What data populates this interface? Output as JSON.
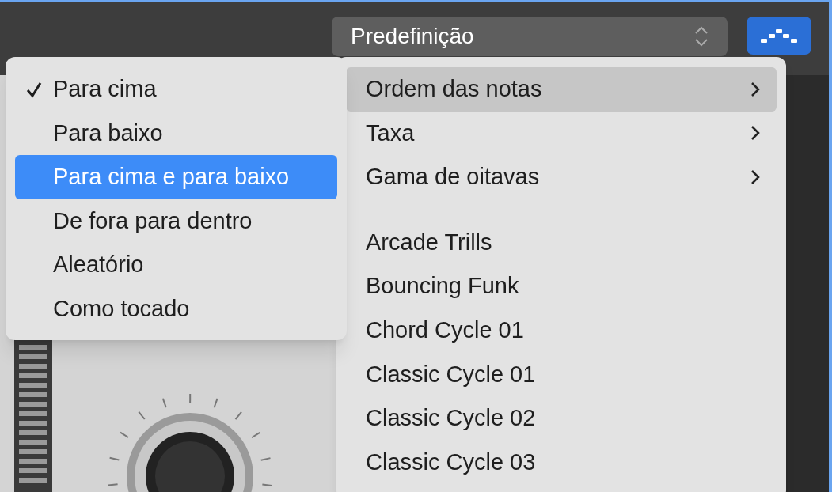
{
  "preset_selector": {
    "label": "Predefinição"
  },
  "arpeggiator_button": {
    "on": true
  },
  "menu": {
    "items": [
      {
        "kind": "submenu",
        "label": "Ordem das notas",
        "selected": true
      },
      {
        "kind": "submenu",
        "label": "Taxa",
        "selected": false
      },
      {
        "kind": "submenu",
        "label": "Gama de oitavas",
        "selected": false
      },
      {
        "kind": "separator"
      },
      {
        "kind": "item",
        "label": "Arcade Trills",
        "selected": false
      },
      {
        "kind": "item",
        "label": "Bouncing Funk",
        "selected": false
      },
      {
        "kind": "item",
        "label": "Chord Cycle 01",
        "selected": false
      },
      {
        "kind": "item",
        "label": "Classic Cycle 01",
        "selected": false
      },
      {
        "kind": "item",
        "label": "Classic Cycle 02",
        "selected": false
      },
      {
        "kind": "item",
        "label": "Classic Cycle 03",
        "selected": false
      }
    ]
  },
  "submenu": {
    "items": [
      {
        "label": "Para cima",
        "checked": true,
        "selected": false
      },
      {
        "label": "Para baixo",
        "checked": false,
        "selected": false
      },
      {
        "label": "Para cima e para baixo",
        "checked": false,
        "selected": true
      },
      {
        "label": "De fora para dentro",
        "checked": false,
        "selected": false
      },
      {
        "label": "Aleatório",
        "checked": false,
        "selected": false
      },
      {
        "label": "Como tocado",
        "checked": false,
        "selected": false
      }
    ]
  }
}
